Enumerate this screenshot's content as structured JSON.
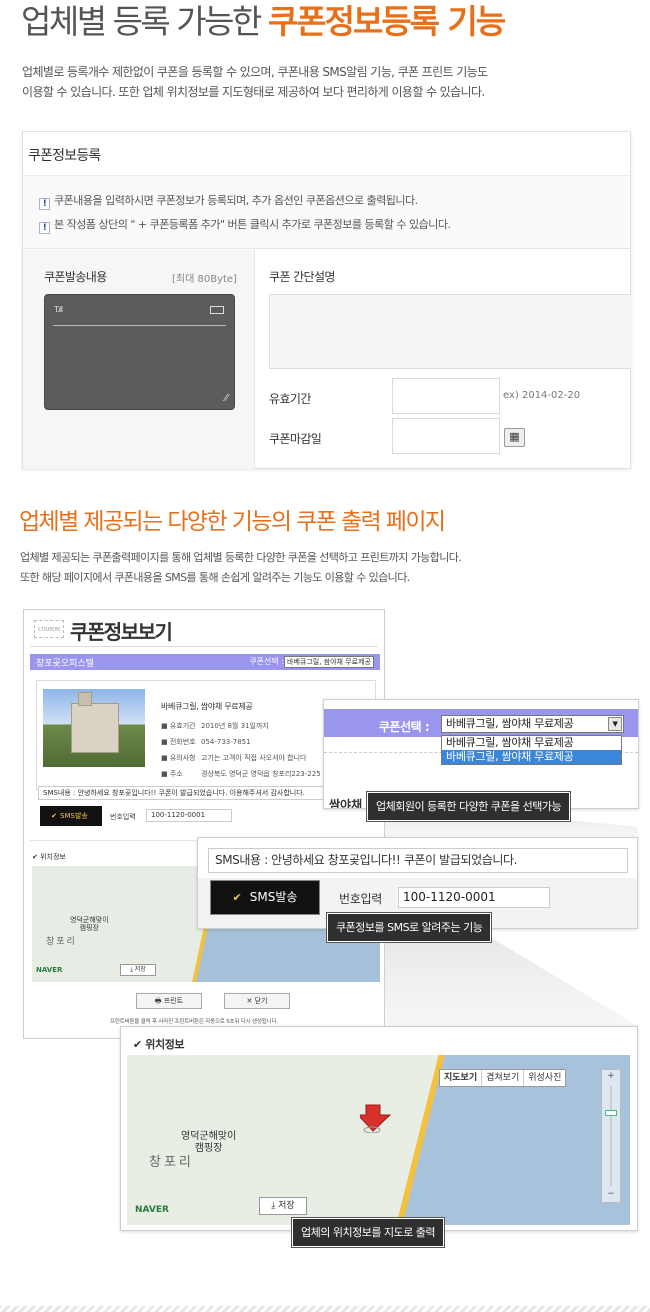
{
  "section1": {
    "title_prefix": "업체별 등록 가능한",
    "title_highlight": "쿠폰정보등록 기능",
    "desc_line1": "업체별로 등록개수 제한없이 쿠폰을 등록할 수 있으며, 쿠폰내용 SMS알림 기능, 쿠폰 프린트 기능도",
    "desc_line2": "이용할 수 있습니다. 또한 업체 위치정보를 지도형태로 제공하여 보다 편리하게 이용할 수 있습니다."
  },
  "panel1": {
    "title": "쿠폰정보등록",
    "note1": "쿠폰내용을 입력하시면 쿠폰정보가 등록되며, 추가 옵션인 쿠폰옵션으로 출력됩니다.",
    "note2": "본 작성폼 상단의 \" + 쿠폰등록폼 추가\" 버튼 클릭시 추가로 쿠폰정보를 등록할 수 있습니다.",
    "send_label": "쿠폰발송내용",
    "max_label": "[최대 80Byte]",
    "desc_label": "쿠폰 간단설명",
    "valid_label": "유효기간",
    "valid_hint": "ex) 2014-02-20",
    "deadline_label": "쿠폰마감일"
  },
  "section2": {
    "title": "업체별 제공되는 다양한 기능의 쿠폰 출력 페이지",
    "desc_line1": "업체별 제공되는 쿠폰출력페이지를 통해 업체별 등록한 다양한 쿠폰을 선택하고 프린트까지 가능합니다.",
    "desc_line2": "또한 해당 페이지에서 쿠폰내용을 SMS를 통해 손쉽게 알려주는 기능도 이용할 수 있습니다."
  },
  "shot": {
    "logo": "COUPON",
    "title": "쿠폰정보보기",
    "shop": "창포곶오피스텔",
    "select_label": "쿠폰선택 :",
    "select_value": "바베큐그릴, 쌈야채 무료제공",
    "coupon_name": "바베큐그릴, 쌈야채 무료제공",
    "rows": [
      {
        "k": "유효기간",
        "v": "2010년 8월 31일까지"
      },
      {
        "k": "전화번호",
        "v": "054-733-7851"
      },
      {
        "k": "유의사항",
        "v": "고기는 고객이 직접 사오셔야 합니다"
      },
      {
        "k": "주소",
        "v": "경상북도 영덕군 영덕읍 창포리223-225"
      }
    ],
    "sms": "SMS내용 : 안녕하세요 창포곶입니다!! 쿠폰이 발급되었습니다. 이용해주셔서 감사합니다.",
    "sms_button": "SMS발송",
    "num_label": "번호입력",
    "num_value": "100-1120-0001",
    "map_title": "위치정보",
    "map_place": "영덕군해맞이\n캠핑장",
    "map_village": "창포리",
    "map_brand": "NAVER",
    "save_button": "저장",
    "print_button": "프린트",
    "close_button": "닫기",
    "print_note": "프린트버튼을 클릭 후 사라진 프린트버튼은 자동으로 5초뒤 다시 생성됩니다."
  },
  "zoom1": {
    "label": "쿠폰선택 :",
    "selected": "바베큐그릴, 쌈야채 무료제공",
    "options": [
      "바베큐그릴, 쌈야채 무료제공",
      "바베큐그릴, 쌈야채 무료제공"
    ],
    "peek_text": "쌈야채",
    "caption": "업체회원이 등록한 다양한 쿠폰을 선택가능"
  },
  "zoom2": {
    "sms": "SMS내용 : 안녕하세요 창포곶입니다!! 쿠폰이 발급되었습니다.",
    "button": "SMS발송",
    "num_label": "번호입력",
    "num_value": "100-1120-0001",
    "caption": "쿠폰정보를 SMS로 알려주는 기능"
  },
  "zoom3": {
    "title": "위치정보",
    "map_buttons": [
      "지도보기",
      "겹쳐보기",
      "위성사진"
    ],
    "place": "영덕군해맞이\n캠핑장",
    "village": "창포리",
    "brand": "NAVER",
    "save_button": "저장",
    "caption": "업체의 위치정보를 지도로 출력"
  },
  "colors": {
    "accent": "#e8701a",
    "purple_bar": "#9a96ee",
    "caption_bg": "#2f2f2f",
    "sea": "#a8c2dc",
    "road": "#f3c23a"
  }
}
